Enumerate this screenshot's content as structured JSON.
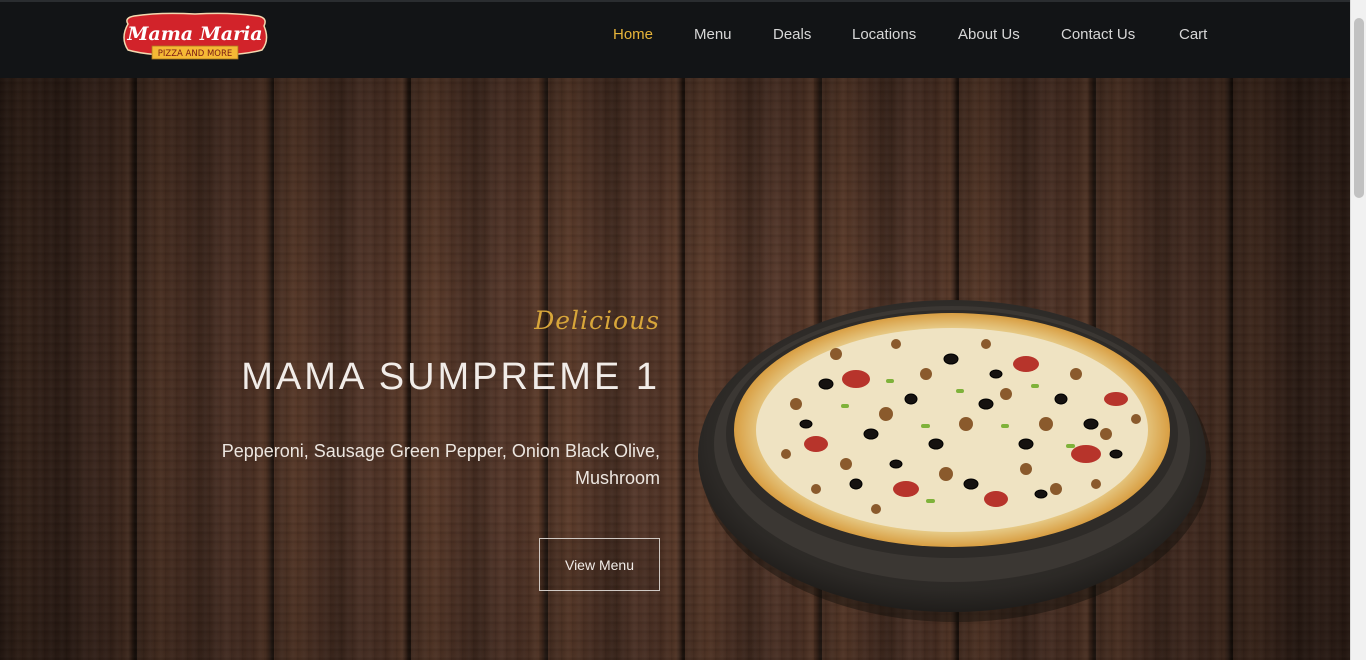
{
  "brand": {
    "logo_name": "Mama Maria",
    "logo_tagline": "PIZZA AND MORE",
    "colors": {
      "logo_red": "#d2232a",
      "logo_yellow": "#f5b935",
      "nav_active": "#e6b43a",
      "accent_script": "#d8a63a"
    }
  },
  "nav": {
    "items": [
      {
        "label": "Home",
        "active": true
      },
      {
        "label": "Menu",
        "active": false
      },
      {
        "label": "Deals",
        "active": false
      },
      {
        "label": "Locations",
        "active": false
      },
      {
        "label": "About Us",
        "active": false
      },
      {
        "label": "Contact Us",
        "active": false
      },
      {
        "label": "Cart",
        "active": false
      }
    ]
  },
  "hero": {
    "script_word": "Delicious",
    "title": "MAMA SUMPREME 1",
    "description": "Pepperoni, Sausage Green Pepper, Onion Black Olive, Mushroom",
    "cta_label": "View Menu",
    "image_subject": "pizza-in-pan"
  }
}
